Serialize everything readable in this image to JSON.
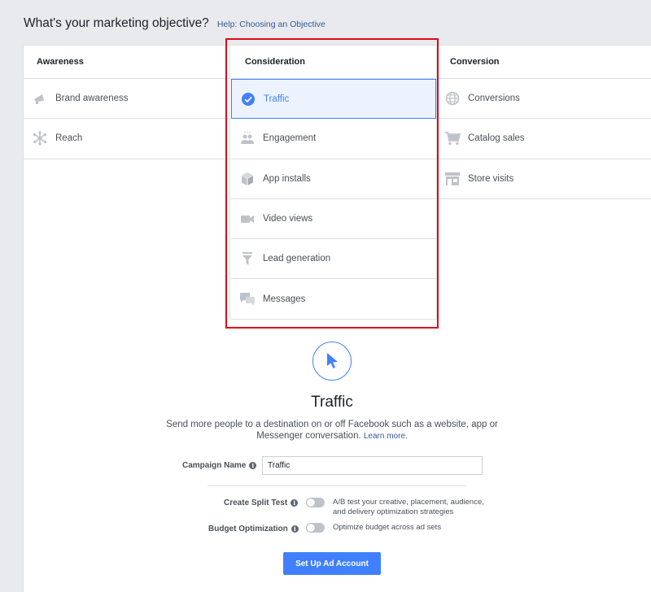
{
  "header": {
    "title": "What's your marketing objective?",
    "help_link": "Help: Choosing an Objective"
  },
  "columns": [
    {
      "heading": "Awareness",
      "items": [
        {
          "label": "Brand awareness",
          "icon": "megaphone-icon"
        },
        {
          "label": "Reach",
          "icon": "reach-icon"
        }
      ]
    },
    {
      "heading": "Consideration",
      "items": [
        {
          "label": "Traffic",
          "icon": "checkmark-circle-icon",
          "selected": true
        },
        {
          "label": "Engagement",
          "icon": "people-icon"
        },
        {
          "label": "App installs",
          "icon": "box-icon"
        },
        {
          "label": "Video views",
          "icon": "video-camera-icon"
        },
        {
          "label": "Lead generation",
          "icon": "funnel-icon"
        },
        {
          "label": "Messages",
          "icon": "chat-bubbles-icon"
        }
      ]
    },
    {
      "heading": "Conversion",
      "items": [
        {
          "label": "Conversions",
          "icon": "globe-icon"
        },
        {
          "label": "Catalog sales",
          "icon": "shopping-cart-icon"
        },
        {
          "label": "Store visits",
          "icon": "store-icon"
        }
      ]
    }
  ],
  "detail": {
    "icon": "cursor-pointer-icon",
    "title": "Traffic",
    "description": "Send more people to a destination on or off Facebook such as a website, app or Messenger conversation.",
    "learn_more": "Learn more."
  },
  "form": {
    "campaign_name_label": "Campaign Name",
    "campaign_name_value": "Traffic",
    "split_test_label": "Create Split Test",
    "split_test_desc": "A/B test your creative, placement, audience, and delivery optimization strategies",
    "split_test_on": false,
    "budget_opt_label": "Budget Optimization",
    "budget_opt_desc": "Optimize budget across ad sets",
    "budget_opt_on": false,
    "submit_label": "Set Up Ad Account"
  },
  "colors": {
    "accent": "#4080ff",
    "highlight_box": "#e0081b",
    "link": "#365899",
    "icon_gray": "#bec2c9"
  }
}
